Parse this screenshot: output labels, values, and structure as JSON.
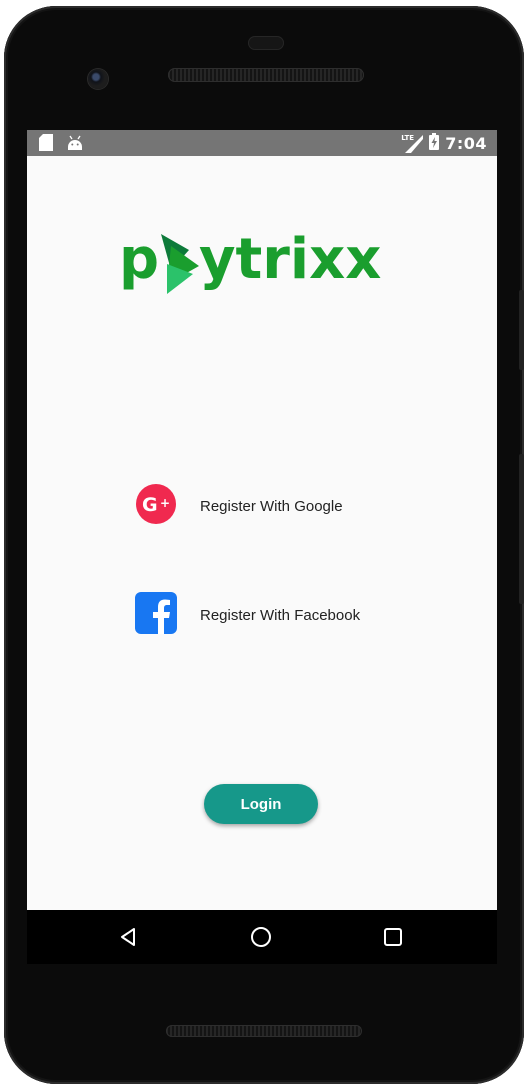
{
  "statusbar": {
    "network_label": "LTE",
    "time": "7:04",
    "icons": [
      "sd-card-icon",
      "android-icon",
      "lte-signal-icon",
      "battery-icon"
    ]
  },
  "brand": {
    "logo_text": "paytrixx",
    "logo_color": "#1a9e2e",
    "play_dark": "#0d7a3a",
    "play_light": "#2bc26a"
  },
  "register": {
    "google_label": "Register With Google",
    "google_color": "#f0294f",
    "facebook_label": "Register With Facebook",
    "facebook_color": "#1877f2"
  },
  "login": {
    "label": "Login",
    "color": "#16988a"
  },
  "navigation": {
    "icons": [
      "back-icon",
      "home-icon",
      "recents-icon"
    ]
  }
}
